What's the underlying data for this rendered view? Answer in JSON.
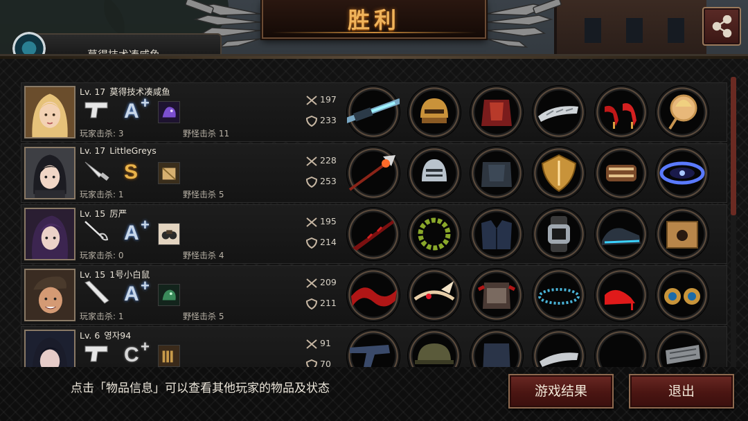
{
  "banner": {
    "title": "胜利"
  },
  "previous_player": {
    "name_partial": "莫得技术凑咸鱼"
  },
  "players": [
    {
      "level": "Lv. 17",
      "name": "莫得技术凑咸鱼",
      "weapon_icon": "pistol-icon",
      "grade": "A",
      "grade_plus": "+",
      "grade_color": "blue",
      "pet_icon": "purple-beast-icon",
      "player_kills_label": "玩家击杀: 3",
      "monster_kills_label": "野怪击杀 11",
      "attack": "197",
      "defense": "233",
      "items": [
        "energy-rifle-icon",
        "golden-helmet-icon",
        "red-armor-icon",
        "silver-gauntlet-icon",
        "red-heels-icon",
        "portrait-mirror-icon"
      ]
    },
    {
      "level": "Lv. 17",
      "name": "LittleGreys",
      "weapon_icon": "knife-icon",
      "grade": "S",
      "grade_plus": "",
      "grade_color": "gold",
      "pet_icon": "gold-box-icon",
      "player_kills_label": "玩家击杀: 1",
      "monster_kills_label": "野怪击杀 5",
      "attack": "228",
      "defense": "253",
      "items": [
        "flaming-spear-icon",
        "knight-helmet-icon",
        "dark-armor-icon",
        "gold-shield-icon",
        "bracer-icon",
        "galaxy-ring-icon"
      ]
    },
    {
      "level": "Lv. 15",
      "name": "厉严",
      "weapon_icon": "rapier-icon",
      "grade": "A",
      "grade_plus": "+",
      "grade_color": "blue",
      "pet_icon": "binocular-icon",
      "player_kills_label": "玩家击杀: 0",
      "monster_kills_label": "野怪击杀 4",
      "attack": "195",
      "defense": "214",
      "items": [
        "crimson-blade-icon",
        "laurel-wreath-icon",
        "suit-jacket-icon",
        "smart-watch-icon",
        "sneaker-icon",
        "supply-crate-icon"
      ]
    },
    {
      "level": "Lv. 15",
      "name": "1号小白鼠",
      "weapon_icon": "bat-icon",
      "grade": "A",
      "grade_plus": "+",
      "grade_color": "blue",
      "pet_icon": "green-creature-icon",
      "player_kills_label": "玩家击杀: 1",
      "monster_kills_label": "野怪击杀 5",
      "attack": "209",
      "defense": "211",
      "items": [
        "red-scarf-icon",
        "winged-tiara-icon",
        "armored-vest-icon",
        "bead-necklace-icon",
        "red-heels-icon",
        "gem-earrings-icon"
      ]
    },
    {
      "level": "Lv. 6",
      "name": "영자94",
      "weapon_icon": "pistol-icon",
      "grade": "C",
      "grade_plus": "+",
      "grade_color": "silver",
      "pet_icon": "ammo-icon",
      "player_kills_label": "",
      "monster_kills_label": "",
      "attack": "91",
      "defense": "70",
      "items": [
        "revolver-icon",
        "army-helmet-icon",
        "blue-suit-icon",
        "steel-bracer-icon",
        "empty-slot-icon",
        "metal-plate-icon"
      ]
    }
  ],
  "footer": {
    "hint": "点击「物品信息」可以查看其他玩家的物品及状态",
    "result_button": "游戏结果",
    "exit_button": "退出"
  },
  "colors": {
    "accent": "#f0b35a",
    "button": "#4a1512",
    "grade_blue": "#c9d8ea",
    "grade_gold": "#e9b34a"
  }
}
